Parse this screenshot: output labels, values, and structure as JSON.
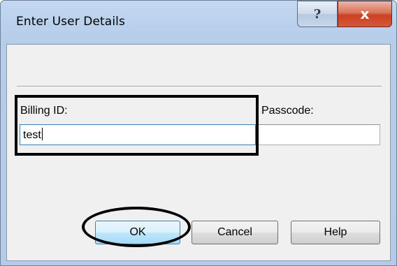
{
  "window": {
    "title": "Enter User Details",
    "help_glyph": "?",
    "close_glyph": "x"
  },
  "form": {
    "billing_label": "Billing ID:",
    "billing_value": "test",
    "passcode_label": "Passcode:",
    "passcode_value": ""
  },
  "buttons": {
    "ok": "OK",
    "cancel": "Cancel",
    "help": "Help"
  },
  "icons": {
    "help": "question-mark-icon",
    "close": "close-icon"
  },
  "colors": {
    "title_gradient": "#b8d0ec",
    "close_button": "#c7421f",
    "focus_border": "#3c7fb1",
    "annotation": "#000000"
  }
}
